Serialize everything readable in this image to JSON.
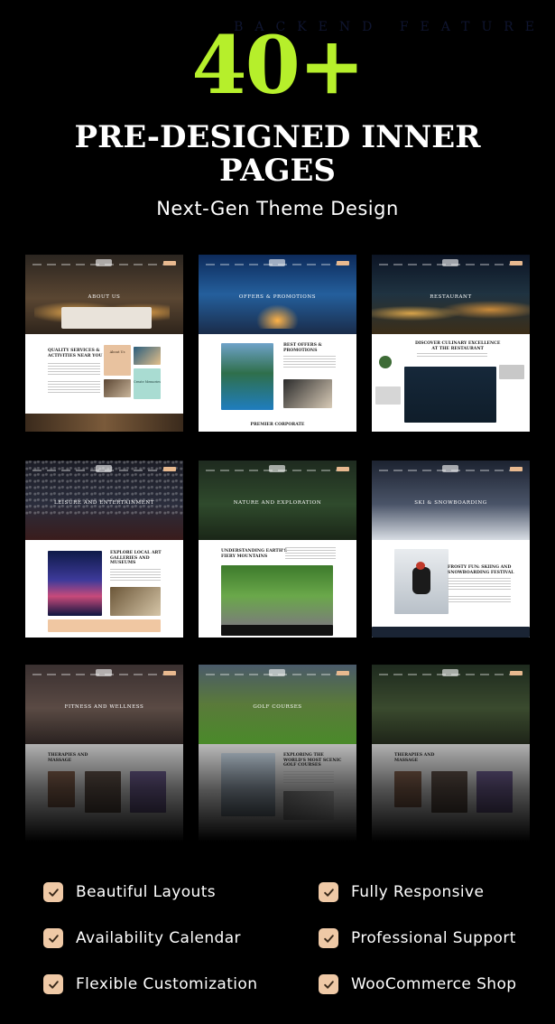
{
  "header": {
    "watermark": "BACKEND FEATURE",
    "count": "40+",
    "headline_line1": "PRE-DESIGNED INNER",
    "headline_line2": "PAGES",
    "tagline": "Next-Gen Theme Design"
  },
  "previews": [
    {
      "title": "ABOUT US",
      "heading": "QUALITY SERVICES &\nACTIVITIES NEAR YOU",
      "sub1": "About Us",
      "sub2": "Create Memories"
    },
    {
      "title": "OFFERS & PROMOTIONS",
      "heading": "BEST OFFERS &\nPROMOTIONS",
      "footer": "PREMIER CORPORATE"
    },
    {
      "title": "RESTAURANT",
      "heading": "DISCOVER CULINARY EXCELLENCE\nAT THE RESTAURANT"
    },
    {
      "title": "LEISURE AND ENTERTAINMENT",
      "heading": "EXPLORE LOCAL ART\nGALLERIES AND\nMUSEUMS"
    },
    {
      "title": "NATURE AND EXPLORATION",
      "heading": "UNDERSTANDING EARTH'S\nFIERY MOUNTAINS"
    },
    {
      "title": "SKI & SNOWBOARDING",
      "heading": "FROSTY FUN: SKIING AND\nSNOWBOARDING FESTIVAL"
    },
    {
      "title": "FITNESS AND WELLNESS",
      "heading": "THERAPIES AND\nMASSAGE"
    },
    {
      "title": "GOLF COURSES",
      "heading": "EXPLORING THE\nWORLD'S MOST SCENIC\nGOLF COURSES"
    },
    {
      "title": "",
      "heading": "THERAPIES AND\nMASSAGE"
    }
  ],
  "features": [
    {
      "label": "Beautiful Layouts",
      "icon": "check-icon"
    },
    {
      "label": "Fully Responsive",
      "icon": "check-icon"
    },
    {
      "label": "Availability Calendar",
      "icon": "check-icon"
    },
    {
      "label": "Professional Support",
      "icon": "check-icon"
    },
    {
      "label": "Flexible Customization",
      "icon": "check-icon"
    },
    {
      "label": "WooCommerce Shop",
      "icon": "check-icon"
    }
  ],
  "colors": {
    "accent": "#b6ef2b",
    "check_bg": "#efc9a6",
    "background": "#000000"
  }
}
